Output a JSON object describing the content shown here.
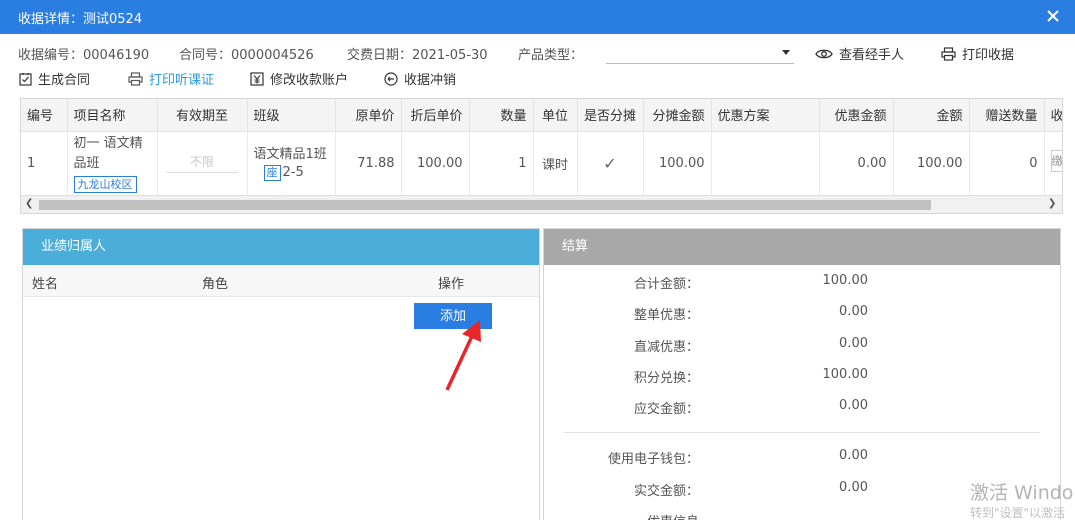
{
  "dialog": {
    "title": "收据详情：测试0524",
    "close_icon": "close-icon"
  },
  "info": {
    "receipt_no": "收据编号：00046190",
    "contract_no": "合同号：0000004526",
    "pay_date": "交费日期：2021-05-30",
    "product_type_label": "产品类型：",
    "product_type_value": ""
  },
  "actions": {
    "view_handler": "查看经手人",
    "print_receipt": "打印收据",
    "generate_contract": "生成合同",
    "print_lesson_voucher": "打印听课证",
    "modify_account": "修改收款账户",
    "receipt_reverse": "收据冲销"
  },
  "grid": {
    "headers": [
      "编号",
      "项目名称",
      "有效期至",
      "班级",
      "原单价",
      "折后单价",
      "数量",
      "单位",
      "是否分摊",
      "分摊金额",
      "优惠方案",
      "优惠金额",
      "金额",
      "赠送数量",
      "收"
    ],
    "row": {
      "no": "1",
      "item_name": "初一 语文精品班",
      "campus_tag": "九龙山校区",
      "valid_until": "不限",
      "class_name": "语文精品1班",
      "room_tag": "座",
      "room": "2-5",
      "original_price": "71.88",
      "discounted_price": "100.00",
      "quantity": "1",
      "unit": "课时",
      "allocated": "✓",
      "allocated_amount": "100.00",
      "discount_plan": "",
      "discount_amount": "0.00",
      "amount": "100.00",
      "gift_quantity": "0",
      "cut_cell": "缴"
    }
  },
  "performance": {
    "title": "业绩归属人",
    "col_name": "姓名",
    "col_role": "角色",
    "col_action": "操作",
    "add_button": "添加"
  },
  "settlement": {
    "title": "结算",
    "rows": [
      {
        "label": "合计金额：",
        "value": "100.00"
      },
      {
        "label": "整单优惠：",
        "value": "0.00"
      },
      {
        "label": "直减优惠：",
        "value": "0.00"
      },
      {
        "label": "积分兑换：",
        "value": "100.00"
      },
      {
        "label": "应交金额：",
        "value": "0.00"
      },
      {
        "label": "使用电子钱包：",
        "value": "0.00"
      },
      {
        "label": "实交金额：",
        "value": "0.00"
      },
      {
        "label": "优惠信息",
        "value": ""
      }
    ]
  },
  "watermark": {
    "line1": "激活 Windo",
    "line2": "转到\"设置\"以激活"
  },
  "colors": {
    "titlebar": "#2a7de1",
    "performance_header": "#4aaed8",
    "settlement_header": "#a8a8a8",
    "annotation_arrow": "#e8262a"
  }
}
